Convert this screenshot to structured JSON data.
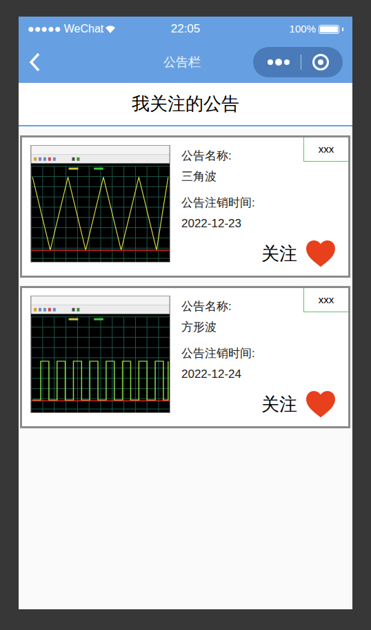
{
  "status_bar": {
    "carrier": "●●●●● WeChat",
    "time": "22:05",
    "battery": "100%",
    "battery_level": 1
  },
  "nav": {
    "title": "公告栏"
  },
  "header": "我关注的公告",
  "notices": [
    {
      "name_label": "公告名称:",
      "name": "三角波",
      "time_label": "公告注销时间:",
      "time": "2022-12-23",
      "tag": "xxx",
      "follow_label": "关注",
      "followed": true,
      "kind": "triangle"
    },
    {
      "name_label": "公告名称:",
      "name": "方形波",
      "time_label": "公告注销时间:",
      "time": "2022-12-24",
      "tag": "xxx",
      "follow_label": "关注",
      "followed": true,
      "kind": "square"
    }
  ]
}
